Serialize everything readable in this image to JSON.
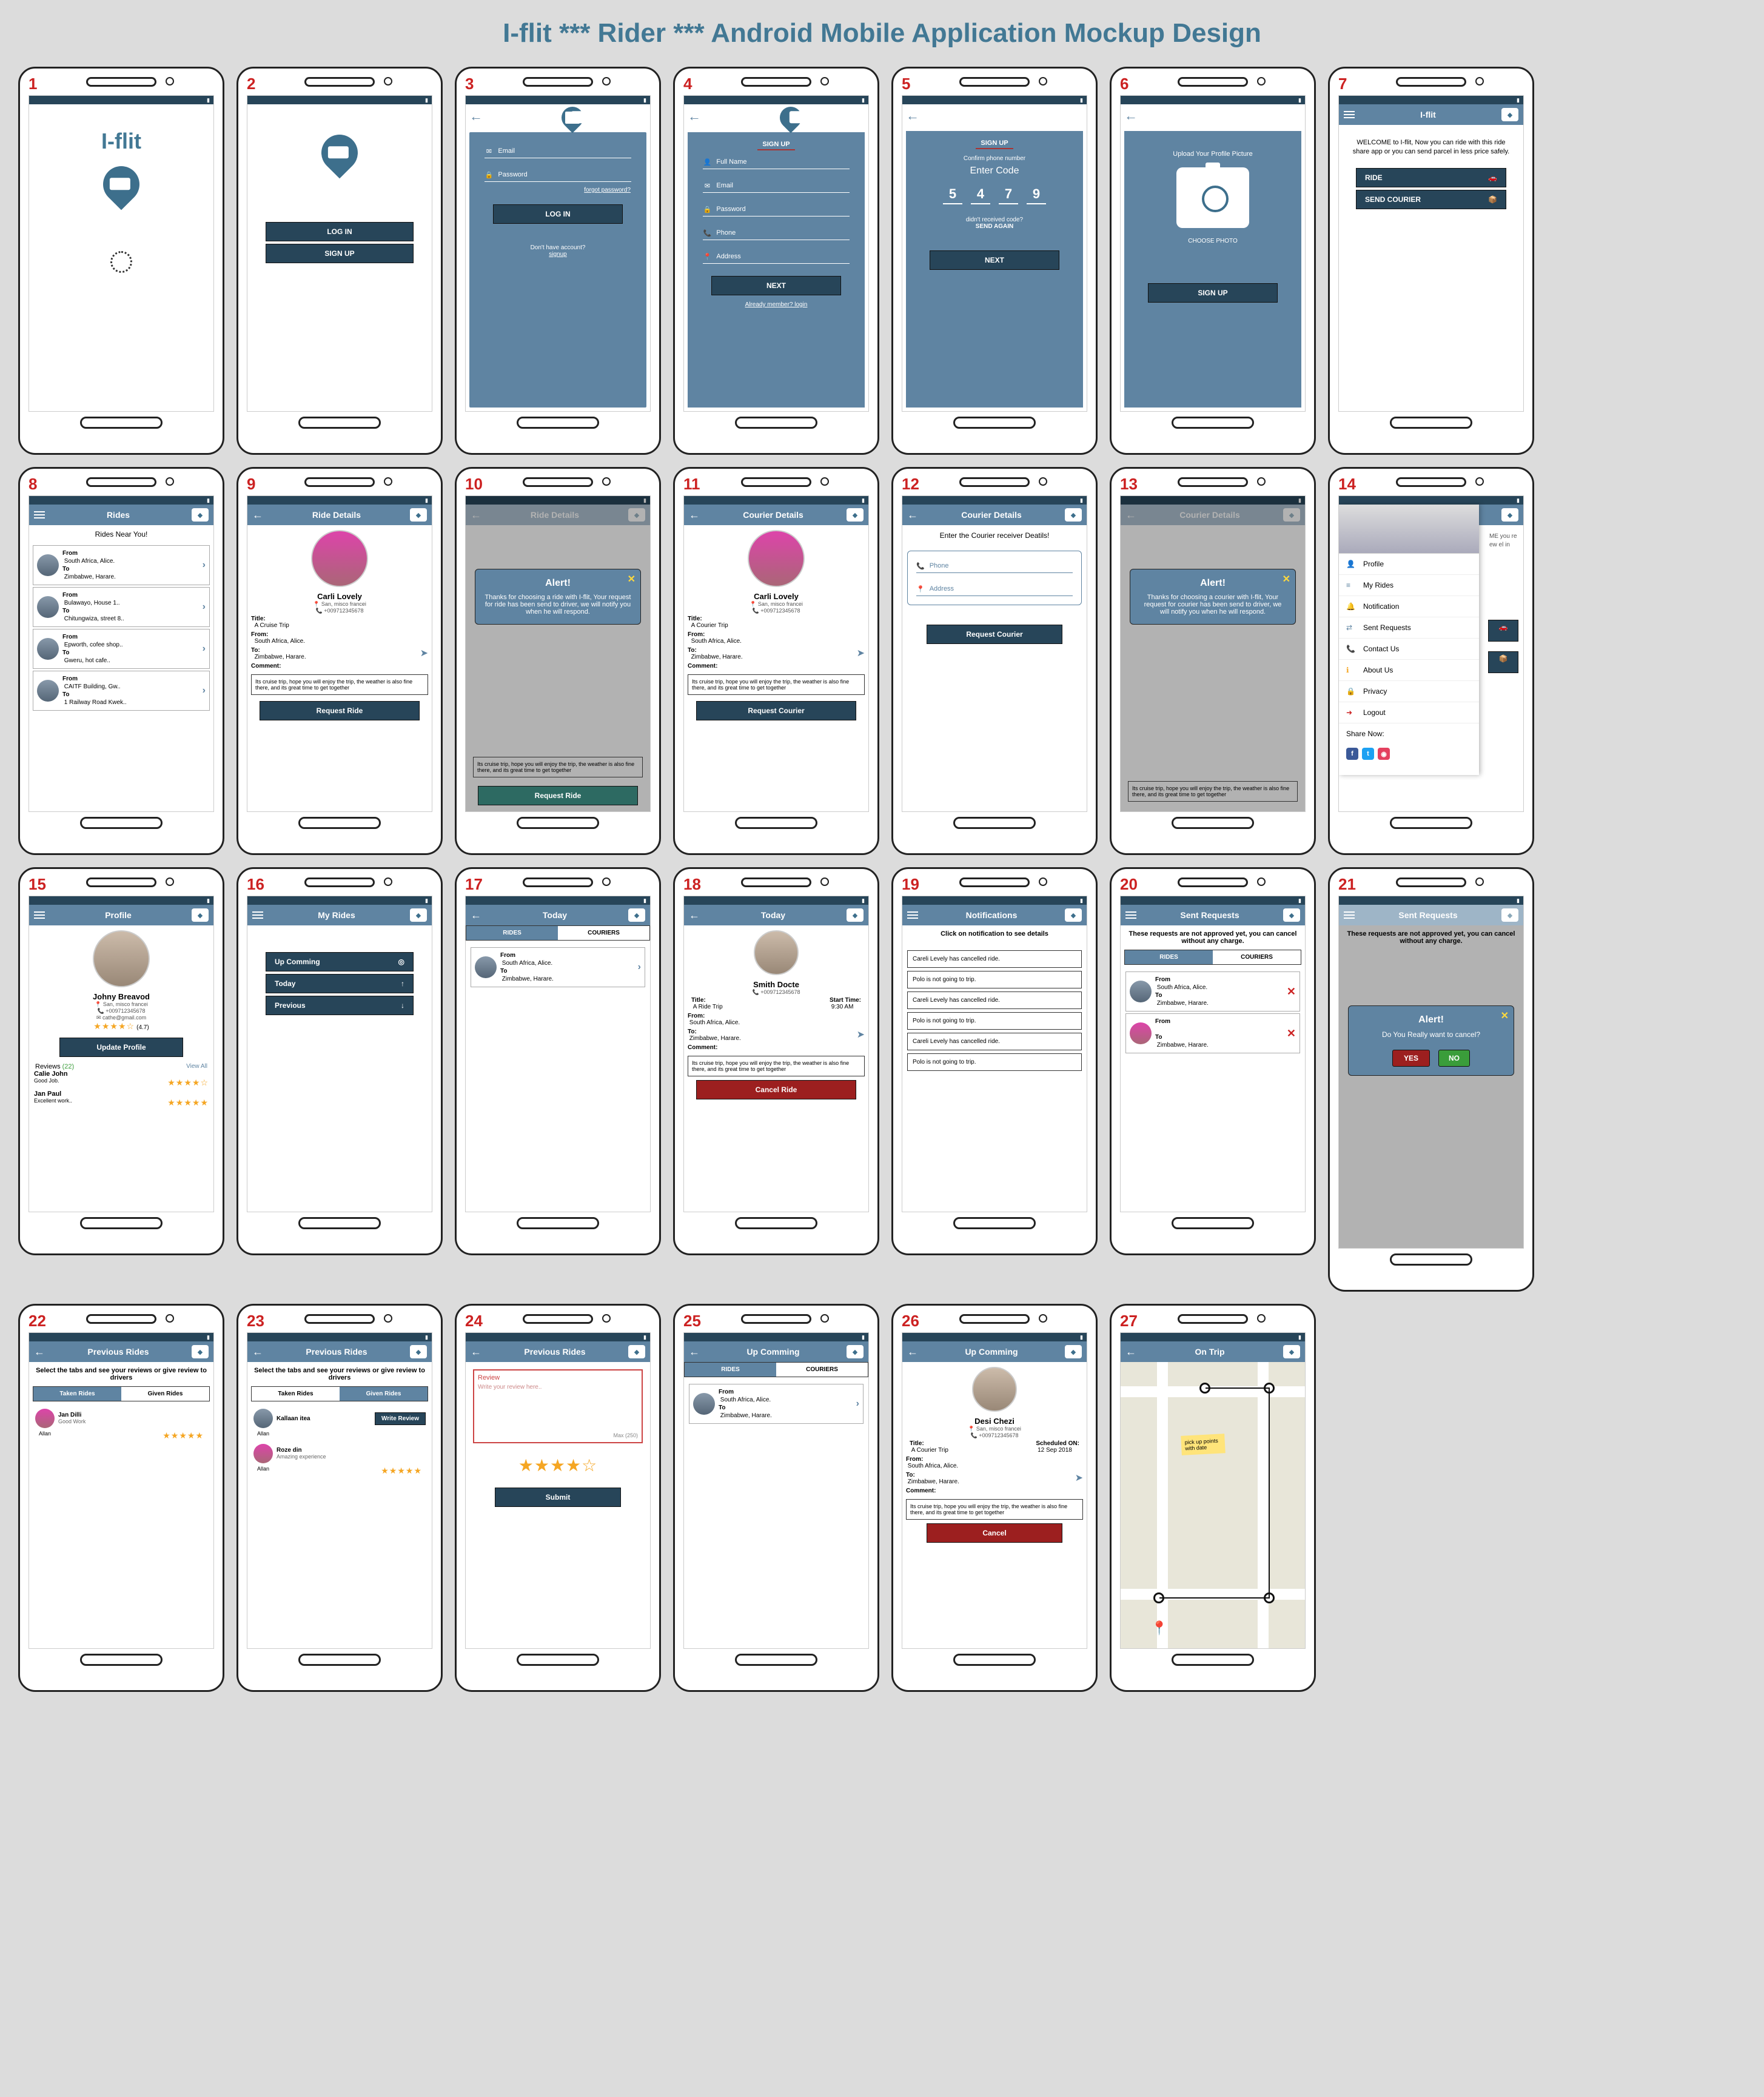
{
  "page_title": "I-flit *** Rider ***  Android Mobile Application Mockup Design",
  "brand": "I-flit",
  "s1": {
    "num": "1"
  },
  "s2": {
    "num": "2",
    "login": "LOG IN",
    "signup": "SIGN UP"
  },
  "s3": {
    "num": "3",
    "email": "Email",
    "password": "Password",
    "forgot": "forgot password?",
    "login": "LOG IN",
    "noacct": "Don't have account?",
    "signup": "signup"
  },
  "s4": {
    "num": "4",
    "head": "SIGN UP",
    "full": "Full Name",
    "email": "Email",
    "password": "Password",
    "phone": "Phone",
    "address": "Address",
    "next": "NEXT",
    "already": "Already member? login"
  },
  "s5": {
    "num": "5",
    "head": "SIGN UP",
    "confirm": "Confirm phone number",
    "enter": "Enter Code",
    "d1": "5",
    "d2": "4",
    "d3": "7",
    "d4": "9",
    "noreceive": "didn't received code?",
    "again": "SEND AGAIN",
    "next": "NEXT"
  },
  "s6": {
    "num": "6",
    "upload": "Upload Your Profile Picture",
    "choose": "CHOOSE PHOTO",
    "signup": "SIGN UP"
  },
  "s7": {
    "num": "7",
    "title": "I-flit",
    "welcome": "WELCOME to I-flit, Now you can ride with this ride share app or you can send parcel in less price safely.",
    "ride": "RIDE",
    "courier": "SEND COURIER"
  },
  "s8": {
    "num": "8",
    "title": "Rides",
    "near": "Rides Near You!",
    "r": [
      {
        "from": "South Africa, Alice.",
        "to": "Zimbabwe, Harare."
      },
      {
        "from": "Bulawayo, House 1..",
        "to": "Chitungwiza, street 8.."
      },
      {
        "from": "Epworth, cofee shop..",
        "to": "Gweru, hot cafe.."
      },
      {
        "from": "CAITF Building, Gw..",
        "to": "1 Railway Road Kwek.."
      }
    ]
  },
  "s9": {
    "num": "9",
    "title": "Ride Details",
    "name": "Carli Lovely",
    "loc": "San, misco francei",
    "ph": "+009712345678",
    "tlabel": "Title:",
    "tval": "A Cruise Trip",
    "flabel": "From:",
    "fval": "South Africa, Alice.",
    "tolabel": "To:",
    "toval": "Zimbabwe, Harare.",
    "clabel": "Comment:",
    "comment": "Its cruise trip, hope you will enjoy the trip, the weather is also fine there, and its great time to get together",
    "btn": "Request Ride"
  },
  "s10": {
    "num": "10",
    "title": "Ride Details",
    "alert": "Alert!",
    "msg": "Thanks for choosing a ride with I-flit, Your request for ride has been send to driver, we will notify you when he will respond.",
    "btn": "Request Ride"
  },
  "s11": {
    "num": "11",
    "title": "Courier Details",
    "name": "Carli Lovely",
    "loc": "San, misco francei",
    "ph": "+009712345678",
    "tlabel": "Title:",
    "tval": "A Courier Trip",
    "flabel": "From:",
    "fval": "South Africa, Alice.",
    "tolabel": "To:",
    "toval": "Zimbabwe, Harare.",
    "clabel": "Comment:",
    "comment": "Its cruise trip, hope you will enjoy the trip, the weather is also fine there, and its great time to get together",
    "btn": "Request Courier"
  },
  "s12": {
    "num": "12",
    "title": "Courier Details",
    "prompt": "Enter the Courier receiver Deatils!",
    "phone": "Phone",
    "address": "Address",
    "btn": "Request Courier"
  },
  "s13": {
    "num": "13",
    "title": "Courier Details",
    "alert": "Alert!",
    "msg": "Thanks for choosing a courier with I-flit, Your request for courier has been send to driver, we will notify you when he will respond."
  },
  "s14": {
    "num": "14",
    "items": [
      "Profile",
      "My Rides",
      "Notification",
      "Sent Requests",
      "Contact Us",
      "About Us",
      "Privacy",
      "Logout"
    ],
    "share": "Share Now:",
    "back_welcome": "ME you re ew el in"
  },
  "s15": {
    "num": "15",
    "title": "Profile",
    "name": "Johny Breavod",
    "loc": "San, misco francei",
    "ph": "+009712345678",
    "email": "cathe@gmail.com",
    "rating": "(4.7)",
    "btn": "Update Profile",
    "rev": "Reviews",
    "rcount": "(22)",
    "va": "View All",
    "r1": "Calie John",
    "r1c": "Good Job.",
    "r2": "Jan Paul",
    "r2c": "Excellent work.."
  },
  "s16": {
    "num": "16",
    "title": "My Rides",
    "up": "Up Comming",
    "today": "Today",
    "prev": "Previous"
  },
  "s17": {
    "num": "17",
    "title": "Today",
    "t1": "RIDES",
    "t2": "COURIERS",
    "from": "South Africa, Alice.",
    "to": "Zimbabwe, Harare."
  },
  "s18": {
    "num": "18",
    "title": "Today",
    "name": "Smith Docte",
    "ph": "+009712345678",
    "tlabel": "Title:",
    "tval": "A Ride Trip",
    "stlabel": "Start Time:",
    "stval": "9:30 AM",
    "flabel": "From:",
    "fval": "South Africa, Alice.",
    "tolabel": "To:",
    "toval": "Zimbabwe, Harare.",
    "clabel": "Comment:",
    "comment": "Its cruise trip, hope you will enjoy the trip, the weather is also fine there, and its great time to get together",
    "btn": "Cancel Ride"
  },
  "s19": {
    "num": "19",
    "title": "Notifications",
    "prompt": "Click on notification to see details",
    "n": [
      "Careli Levely has cancelled ride.",
      "Polo is not going to trip.",
      "Careli Levely has cancelled ride.",
      "Polo is not going to trip.",
      "Careli Levely has cancelled ride.",
      "Polo is not going to trip."
    ]
  },
  "s20": {
    "num": "20",
    "title": "Sent Requests",
    "msg": "These requests are not approved yet, you can cancel without any charge.",
    "t1": "RIDES",
    "t2": "COURIERS",
    "from": "South Africa, Alice.",
    "to": "Zimbabwe, Harare."
  },
  "s21": {
    "num": "21",
    "title": "Sent Requests",
    "msg": "These requests are not approved yet, you can cancel without any charge.",
    "alert": "Alert!",
    "q": "Do You Really want to cancel?",
    "yes": "YES",
    "no": "NO"
  },
  "s22": {
    "num": "22",
    "title": "Previous Rides",
    "msg": "Select the tabs and see your reviews or give review to drivers",
    "t1": "Taken Rides",
    "t2": "Given Rides",
    "name": "Jan Dilli",
    "c": "Good Work",
    "who": "Allan"
  },
  "s23": {
    "num": "23",
    "title": "Previous Rides",
    "msg": "Select the tabs and see your reviews or give review to drivers",
    "t1": "Taken Rides",
    "t2": "Given Rides",
    "n1": "Kallaan itea",
    "b1": "Write Review",
    "n2": "Roze din",
    "c2": "Amazing experience",
    "who": "Allan"
  },
  "s24": {
    "num": "24",
    "title": "Previous Rides",
    "rev": "Review",
    "ph": "Write your review here..",
    "max": "Max (250)",
    "btn": "Submit"
  },
  "s25": {
    "num": "25",
    "title": "Up Comming",
    "t1": "RIDES",
    "t2": "COURIERS",
    "from": "South Africa, Alice.",
    "to": "Zimbabwe, Harare."
  },
  "s26": {
    "num": "26",
    "title": "Up Comming",
    "name": "Desi Chezi",
    "loc": "San, misco francei",
    "ph": "+009712345678",
    "tlabel": "Title:",
    "tval": "A Courier Trip",
    "slabel": "Scheduled ON:",
    "sval": "12 Sep 2018",
    "flabel": "From:",
    "fval": "South Africa, Alice.",
    "tolabel": "To:",
    "toval": "Zimbabwe, Harare.",
    "clabel": "Comment:",
    "comment": "Its cruise trip, hope you will enjoy the trip, the weather is also fine there, and its great time to get together",
    "btn": "Cancel"
  },
  "s27": {
    "num": "27",
    "title": "On Trip",
    "sticky": "pick up points with date"
  },
  "labels": {
    "from": "From",
    "to": "To"
  }
}
